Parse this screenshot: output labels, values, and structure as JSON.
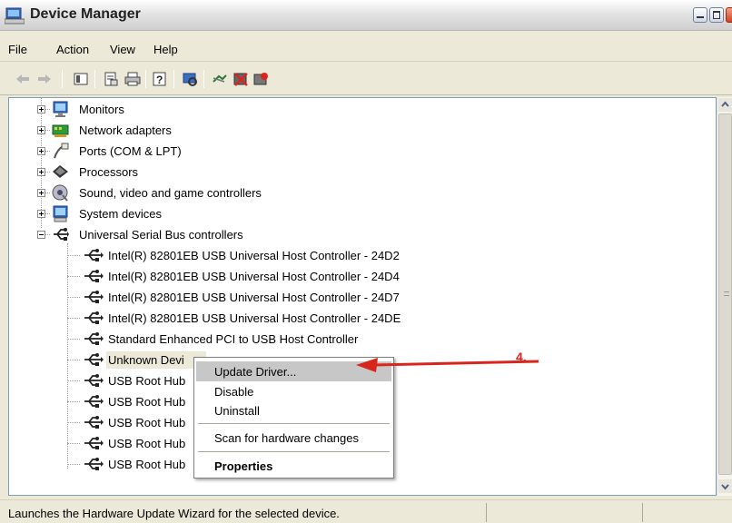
{
  "window": {
    "title": "Device Manager"
  },
  "menu": [
    "File",
    "Action",
    "View",
    "Help"
  ],
  "toolbar": {
    "buttons": [
      "back-icon",
      "forward-icon",
      "console-tree-icon",
      "properties-icon",
      "print-icon",
      "help-icon",
      "scan-hardware-icon",
      "update-driver-icon",
      "uninstall-icon",
      "disable-icon"
    ]
  },
  "tree": {
    "categories": [
      {
        "label": "Monitors",
        "icon": "monitor-icon",
        "expanded": false
      },
      {
        "label": "Network adapters",
        "icon": "network-adapter-icon",
        "expanded": false
      },
      {
        "label": "Ports (COM & LPT)",
        "icon": "port-icon",
        "expanded": false
      },
      {
        "label": "Processors",
        "icon": "processor-icon",
        "expanded": false
      },
      {
        "label": "Sound, video and game controllers",
        "icon": "sound-icon",
        "expanded": false
      },
      {
        "label": "System devices",
        "icon": "system-devices-icon",
        "expanded": false
      },
      {
        "label": "Universal Serial Bus controllers",
        "icon": "usb-icon",
        "expanded": true
      }
    ],
    "usb_devices": [
      "Intel(R) 82801EB USB Universal Host Controller - 24D2",
      "Intel(R) 82801EB USB Universal Host Controller - 24D4",
      "Intel(R) 82801EB USB Universal Host Controller - 24D7",
      "Intel(R) 82801EB USB Universal Host Controller - 24DE",
      "Standard Enhanced PCI to USB Host Controller",
      "Unknown Devi",
      "USB Root Hub",
      "USB Root Hub",
      "USB Root Hub",
      "USB Root Hub",
      "USB Root Hub"
    ],
    "selected": "Unknown Devi"
  },
  "context_menu": {
    "items": [
      "Update Driver...",
      "Disable",
      "Uninstall",
      "Scan for hardware changes",
      "Properties"
    ],
    "highlighted": "Update Driver..."
  },
  "annotation": {
    "number": "4.",
    "color": "#d9261c"
  },
  "status": {
    "text": "Launches the Hardware Update Wizard for the selected device."
  }
}
